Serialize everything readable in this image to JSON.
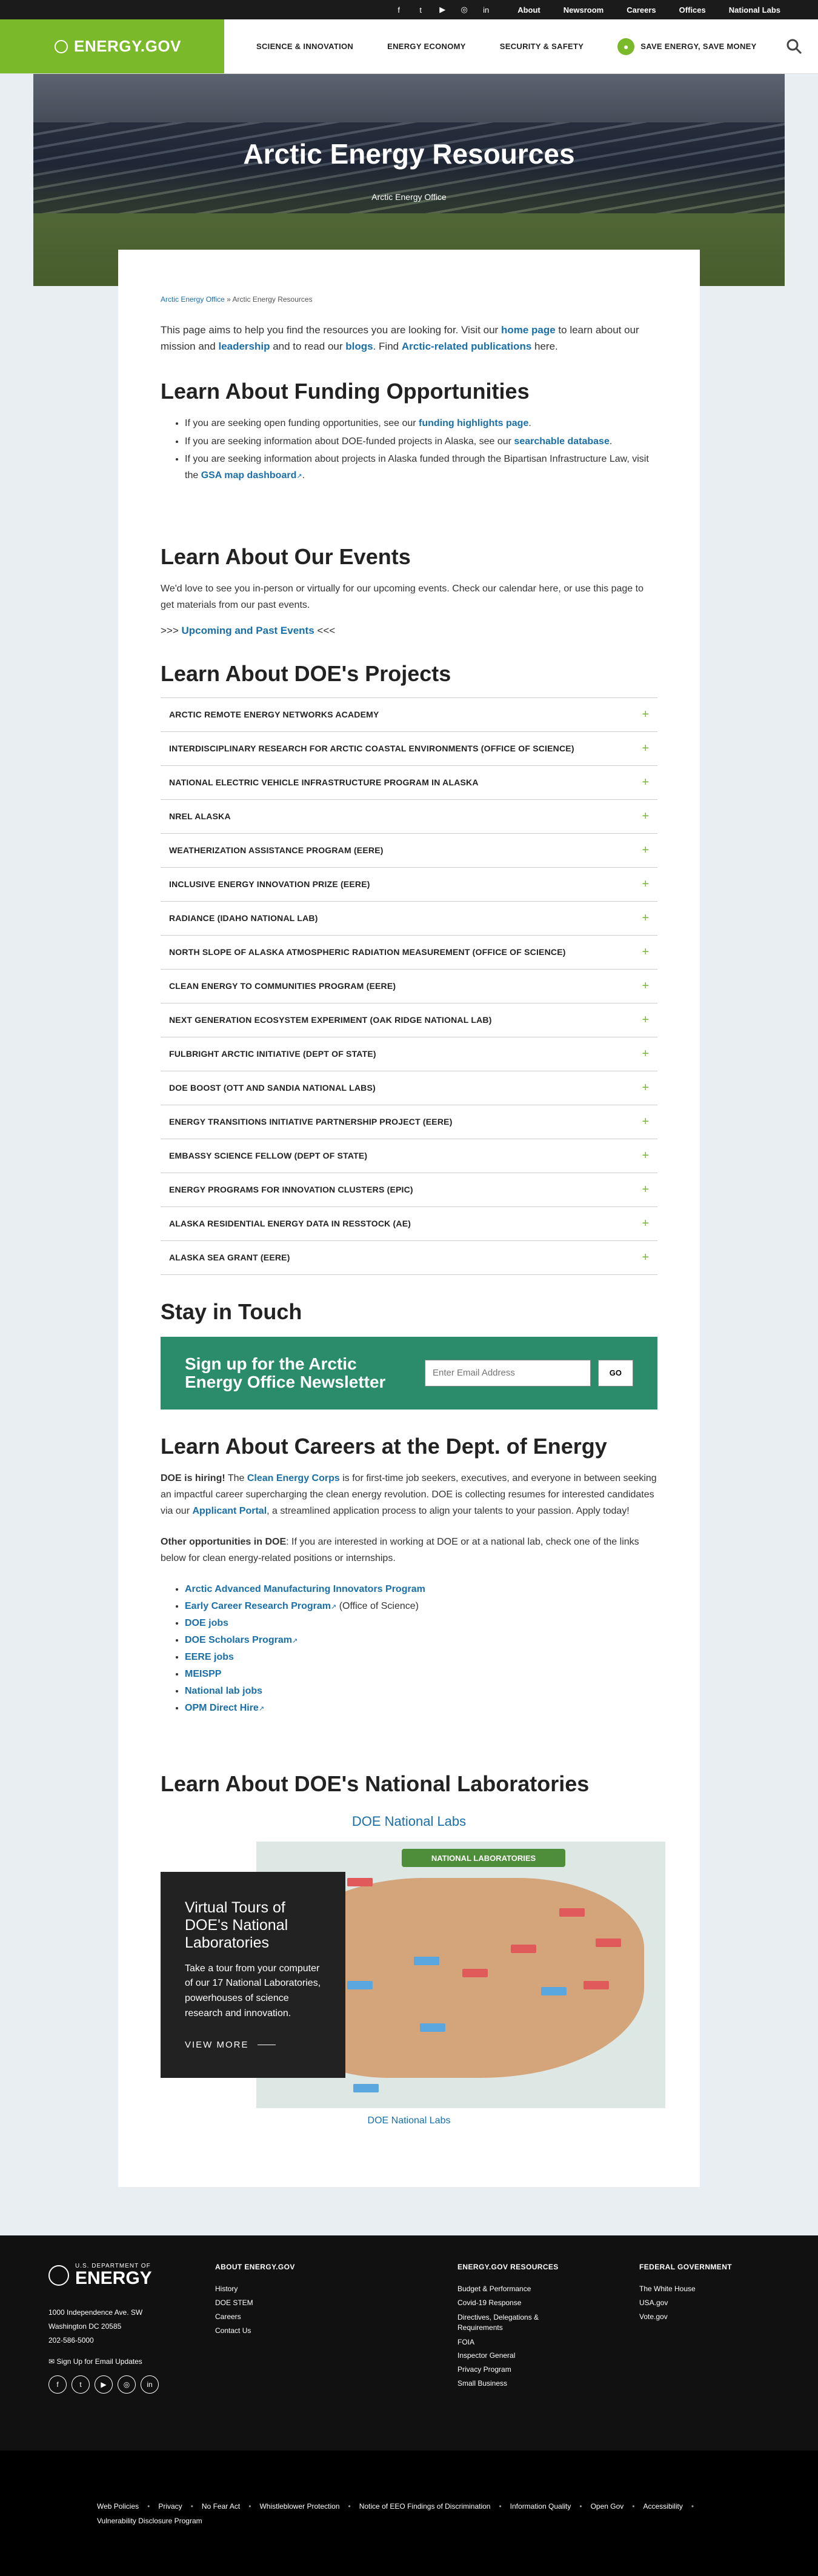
{
  "utility": {
    "social_icons": [
      "facebook-icon",
      "twitter-icon",
      "youtube-icon",
      "instagram-icon",
      "linkedin-icon"
    ],
    "links": [
      "About",
      "Newsroom",
      "Careers",
      "Offices",
      "National Labs"
    ]
  },
  "header": {
    "logo": "ENERGY.GOV",
    "nav": [
      "SCIENCE & INNOVATION",
      "ENERGY ECONOMY",
      "SECURITY & SAFETY"
    ],
    "save": "SAVE ENERGY, SAVE MONEY"
  },
  "hero": {
    "title": "Arctic Energy Resources",
    "subtitle": "Arctic Energy Office"
  },
  "breadcrumb": {
    "office": "Arctic Energy Office",
    "sep": " » ",
    "current": "Arctic Energy Resources"
  },
  "intro": {
    "t1": "This page aims to help you find the resources you are looking for. Visit our ",
    "home_link": "home page",
    "t2": " to learn about our mission and ",
    "leadership_link": "leadership",
    "t3": " and to read our ",
    "blogs_link": "blogs",
    "t4": ". Find ",
    "pubs_link": "Arctic-related publications",
    "t5": " here."
  },
  "funding": {
    "heading": "Learn About Funding Opportunities",
    "b1_text": "If you are seeking open funding opportunities, see our ",
    "b1_link": "funding highlights page",
    "b1_end": ".",
    "b2_text": "If you are seeking information about DOE-funded projects in Alaska, see our ",
    "b2_link": "searchable database",
    "b2_end": ".",
    "b3_text": "If you are seeking information about projects in Alaska funded through the Bipartisan Infrastructure Law, visit the ",
    "b3_link": "GSA map dashboard",
    "b3_end": "."
  },
  "events": {
    "heading": "Learn About Our Events",
    "text": "We'd love to see you in-person or virtually for our upcoming events. Check our calendar here, or use this page to get materials from our past events.",
    "prefix": ">>> ",
    "link": "Upcoming and Past Events",
    "suffix": " <<<"
  },
  "projects": {
    "heading": "Learn About DOE's Projects",
    "items": [
      "ARCTIC REMOTE ENERGY NETWORKS ACADEMY",
      "INTERDISCIPLINARY RESEARCH FOR ARCTIC COASTAL ENVIRONMENTS (OFFICE OF SCIENCE)",
      "NATIONAL ELECTRIC VEHICLE INFRASTRUCTURE PROGRAM IN ALASKA",
      "NREL ALASKA",
      "WEATHERIZATION ASSISTANCE PROGRAM (EERE)",
      "INCLUSIVE ENERGY INNOVATION PRIZE (EERE)",
      "RADIANCE (IDAHO NATIONAL LAB)",
      "NORTH SLOPE OF ALASKA ATMOSPHERIC RADIATION MEASUREMENT (OFFICE OF SCIENCE)",
      "CLEAN ENERGY TO COMMUNITIES PROGRAM (EERE)",
      "NEXT GENERATION ECOSYSTEM EXPERIMENT (OAK RIDGE NATIONAL LAB)",
      "FULBRIGHT ARCTIC INITIATIVE (DEPT OF STATE)",
      "DOE BOOST (OTT AND SANDIA NATIONAL LABS)",
      "ENERGY TRANSITIONS INITIATIVE PARTNERSHIP PROJECT (EERE)",
      "EMBASSY SCIENCE FELLOW (DEPT OF STATE)",
      "ENERGY PROGRAMS FOR INNOVATION CLUSTERS (EPIC)",
      "ALASKA RESIDENTIAL ENERGY DATA IN RESSTOCK (AE)",
      "ALASKA SEA GRANT (EERE)"
    ]
  },
  "stay": {
    "heading": "Stay in Touch",
    "newsletter_title": "Sign up for the Arctic Energy Office Newsletter",
    "email_placeholder": "Enter Email Address",
    "go": "GO"
  },
  "careers": {
    "heading": "Learn About Careers at the Dept. of Energy",
    "p1_bold": "DOE is hiring!",
    "p1_a": " The ",
    "p1_link": "Clean Energy Corps",
    "p1_b": " is for first-time job seekers, executives, and everyone in between seeking an impactful career supercharging the clean energy revolution. DOE is collecting resumes for interested candidates via our ",
    "p1_link2": "Applicant Portal",
    "p1_c": ", a streamlined application process to align your talents to your passion. Apply today!",
    "p2_bold": "Other opportunities in DOE",
    "p2_text": ": If you are interested in working at DOE or at a national lab, check one of the links below for clean energy-related positions or internships.",
    "links": [
      "Arctic Advanced Manufacturing Innovators Program",
      "Early Career Research Program",
      "DOE jobs",
      "DOE Scholars Program",
      "EERE jobs",
      "MEISPP",
      "National lab jobs",
      "OPM Direct Hire"
    ],
    "ecrp_suffix": " (Office of Science)"
  },
  "labs": {
    "heading": "Learn About DOE's National Laboratories",
    "map_title": "DOE National Labs",
    "map_banner": "NATIONAL LABORATORIES",
    "card_title": "Virtual Tours of DOE's National Laboratories",
    "card_text": "Take a tour from your computer of our 17 National Laboratories, powerhouses of science research and innovation.",
    "card_button": "VIEW MORE",
    "caption": "DOE National Labs"
  },
  "footer": {
    "brand_small": "U.S. DEPARTMENT OF",
    "brand_big": "ENERGY",
    "addr1": "1000 Independence Ave. SW",
    "addr2": "Washington DC 20585",
    "phone": "202-586-5000",
    "email_signup": "Sign Up for Email Updates",
    "social_icons": [
      "facebook-icon",
      "twitter-icon",
      "youtube-icon",
      "instagram-icon",
      "linkedin-icon"
    ],
    "col1_title": "ABOUT ENERGY.GOV",
    "col1": [
      "History",
      "DOE STEM",
      "Careers",
      "Contact Us"
    ],
    "col2_title": "ENERGY.GOV RESOURCES",
    "col2": [
      "Budget & Performance",
      "Covid-19 Response",
      "Directives, Delegations & Requirements",
      "FOIA",
      "Inspector General",
      "Privacy Program",
      "Small Business"
    ],
    "col3_title": "FEDERAL GOVERNMENT",
    "col3": [
      "The White House",
      "USA.gov",
      "Vote.gov"
    ],
    "sub_links": [
      "Web Policies",
      "Privacy",
      "No Fear Act",
      "Whistleblower Protection",
      "Notice of EEO Findings of Discrimination",
      "Information Quality",
      "Open Gov",
      "Accessibility",
      "Vulnerability Disclosure Program"
    ]
  },
  "colors": {
    "brand_green": "#7ab929",
    "link_blue": "#1a6fa8",
    "newsletter_green": "#2a8c6a"
  }
}
